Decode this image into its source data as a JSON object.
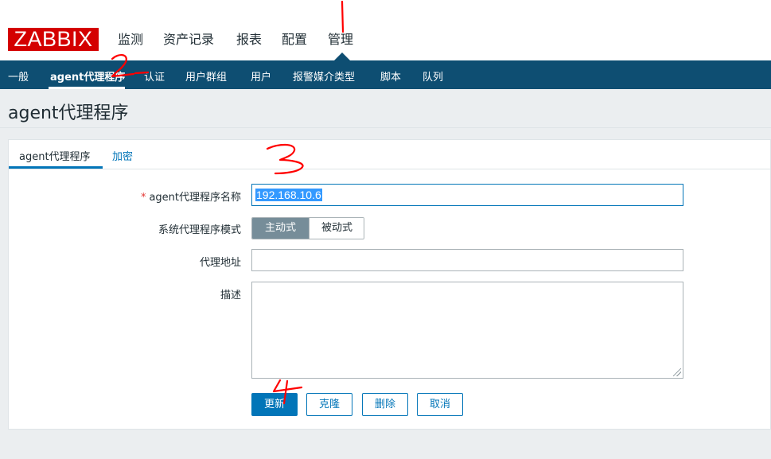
{
  "header": {
    "logo": "ZABBIX",
    "menu": [
      "监测",
      "资产记录",
      "报表",
      "配置",
      "管理"
    ],
    "active_menu": "管理"
  },
  "subnav": {
    "items": [
      "一般",
      "agent代理程序",
      "认证",
      "用户群组",
      "用户",
      "报警媒介类型",
      "脚本",
      "队列"
    ],
    "active": "agent代理程序"
  },
  "page": {
    "title": "agent代理程序"
  },
  "tabs": [
    {
      "label": "agent代理程序",
      "active": true
    },
    {
      "label": "加密",
      "active": false
    }
  ],
  "form": {
    "name_label": "agent代理程序名称",
    "name_required_mark": "*",
    "name_value": "192.168.10.6",
    "mode_label": "系统代理程序模式",
    "mode_options": [
      "主动式",
      "被动式"
    ],
    "mode_selected": "主动式",
    "address_label": "代理地址",
    "address_value": "",
    "description_label": "描述",
    "description_value": ""
  },
  "buttons": {
    "update": "更新",
    "clone": "克隆",
    "delete": "删除",
    "cancel": "取消"
  },
  "annotations": {
    "marks": [
      "1",
      "2",
      "3",
      "4"
    ],
    "color": "#ff0000"
  },
  "colors": {
    "brand_red": "#d40000",
    "nav_blue": "#0e4e72",
    "accent": "#0275b8"
  }
}
